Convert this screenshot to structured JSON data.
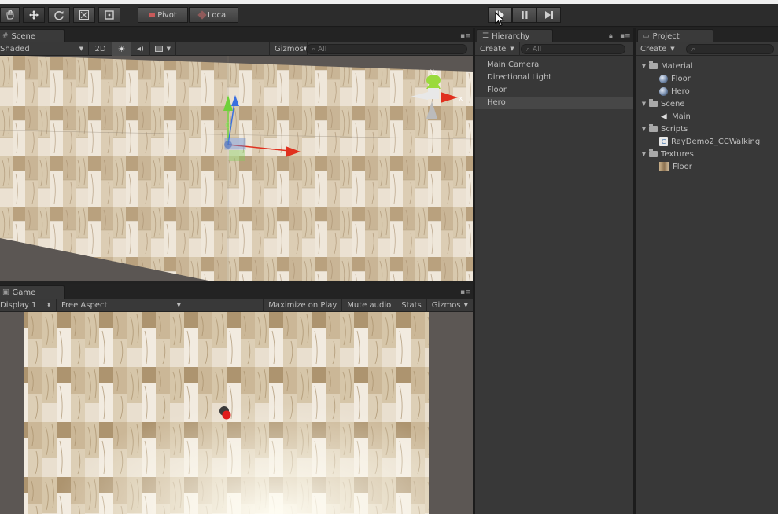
{
  "toolbar": {
    "tools": [
      "hand-tool",
      "move-tool",
      "rotate-tool",
      "scale-tool",
      "rect-tool"
    ],
    "pivot_label": "Pivot",
    "local_label": "Local",
    "play_icon": "play-icon",
    "pause_icon": "pause-icon",
    "step_icon": "step-icon"
  },
  "scene": {
    "tab_label": "Scene",
    "draw_mode": "Shaded",
    "mode_2d": "2D",
    "gizmos_label": "Gizmos",
    "search_placeholder": "All",
    "gizmo_axis_y": "y",
    "gizmo_axis_z": "z",
    "gizmo_axis_x": "x"
  },
  "game": {
    "tab_label": "Game",
    "display": "Display 1",
    "aspect": "Free Aspect",
    "maximize_label": "Maximize on Play",
    "mute_label": "Mute audio",
    "stats_label": "Stats",
    "gizmos_label": "Gizmos"
  },
  "hierarchy": {
    "tab_label": "Hierarchy",
    "create_label": "Create",
    "search_placeholder": "All",
    "items": [
      {
        "label": "Main Camera"
      },
      {
        "label": "Directional Light"
      },
      {
        "label": "Floor"
      },
      {
        "label": "Hero"
      }
    ],
    "selected_index": 3
  },
  "project": {
    "tab_label": "Project",
    "create_label": "Create",
    "tree": [
      {
        "label": "Material",
        "type": "folder"
      },
      {
        "label": "Floor",
        "type": "material"
      },
      {
        "label": "Hero",
        "type": "material"
      },
      {
        "label": "Scene",
        "type": "folder"
      },
      {
        "label": "Main",
        "type": "scene"
      },
      {
        "label": "Scripts",
        "type": "folder"
      },
      {
        "label": "RayDemo2_CCWalking",
        "type": "script"
      },
      {
        "label": "Textures",
        "type": "folder"
      },
      {
        "label": "Floor",
        "type": "texture"
      }
    ]
  },
  "colors": {
    "wood_light": "#e6dccb",
    "wood_mid": "#cdbc9f",
    "wood_dark": "#9c8362",
    "hero_red": "#e01c1c",
    "axis_red": "#e0301e",
    "axis_green": "#6fd13a",
    "axis_blue": "#3a6fe0"
  }
}
